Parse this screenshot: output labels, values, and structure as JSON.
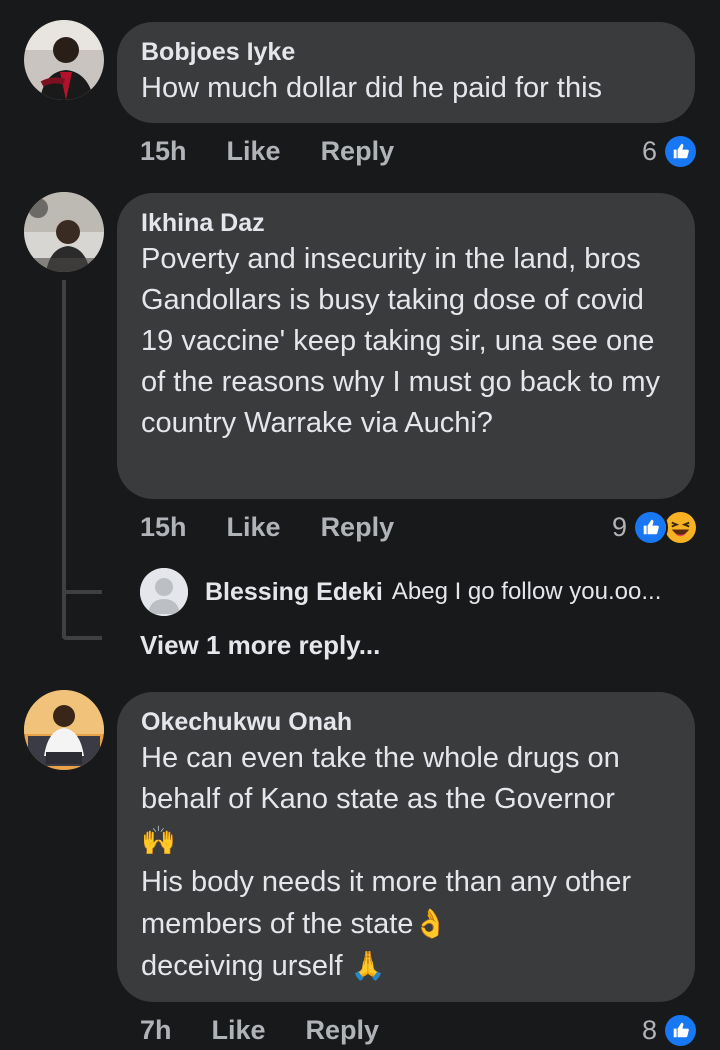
{
  "comments": [
    {
      "author": "Bobjoes Iyke",
      "text": "How  much dollar did he paid for this",
      "time": "15h",
      "like_label": "Like",
      "reply_label": "Reply",
      "reaction_count": "6",
      "reactions": [
        "like-reaction"
      ]
    },
    {
      "author": "Ikhina Daz",
      "text": "Poverty and insecurity in the land, bros Gandollars is busy taking dose of covid 19 vaccine' keep taking sir, una see one of the reasons why I must go back to my country Warrake via Auchi?",
      "time": "15h",
      "like_label": "Like",
      "reply_label": "Reply",
      "reaction_count": "9",
      "reactions": [
        "like-reaction",
        "haha-reaction"
      ],
      "reply_preview": {
        "author": "Blessing Edeki",
        "text": "Abeg I go follow you.oo..."
      },
      "view_more_label": "View 1 more reply..."
    },
    {
      "author": "Okechukwu Onah",
      "text_line1": "He can even take the whole drugs on behalf of Kano state as the Governor",
      "emoji1": "🙌",
      "text_line2": "His body needs it more than any other members of the state",
      "emoji2": "👌",
      "text_line3": "deceiving urself ",
      "emoji3": "🙏",
      "time": "7h",
      "like_label": "Like",
      "reply_label": "Reply",
      "reaction_count": "8",
      "reactions": [
        "like-reaction"
      ]
    }
  ],
  "colors": {
    "background": "#18191a",
    "bubble": "#3a3b3c",
    "primary_text": "#e4e6eb",
    "secondary_text": "#b0b3b8",
    "like_blue": "#1877f2",
    "haha_yellow": "#f7b125"
  }
}
